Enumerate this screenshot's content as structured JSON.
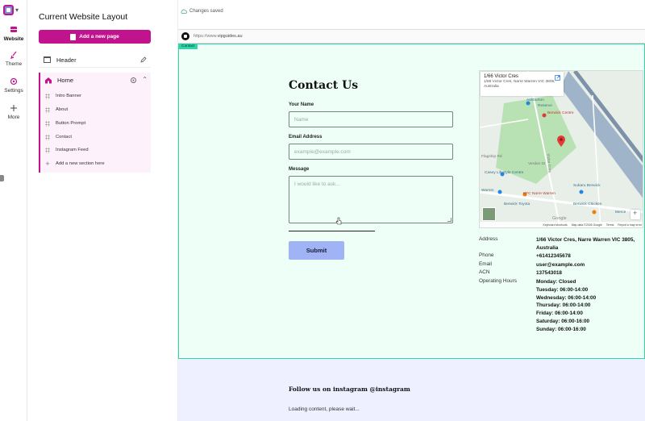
{
  "rail": {
    "items": [
      {
        "label": "Website"
      },
      {
        "label": "Theme"
      },
      {
        "label": "Settings"
      },
      {
        "label": "More"
      }
    ]
  },
  "panel": {
    "title": "Current Website Layout",
    "add_page_label": "Add a new page",
    "header_label": "Header",
    "home": {
      "label": "Home",
      "sections": [
        "Intro Banner",
        "About",
        "Button Prompt",
        "Contact",
        "Instagram Feed"
      ],
      "add_section_label": "Add a new section here"
    }
  },
  "status": {
    "text": "Changes saved"
  },
  "browser": {
    "url_prefix": "https://www.",
    "url_domain": "vipguides.au"
  },
  "contact": {
    "section_tag": "Contact",
    "title": "Contact Us",
    "name_label": "Your Name",
    "name_placeholder": "Name",
    "email_label": "Email Address",
    "email_placeholder": "example@example.com",
    "message_label": "Message",
    "message_placeholder": "I would like to ask...",
    "submit_label": "Submit",
    "map": {
      "place_name": "1/66 Victor Cres",
      "place_address": "1/66 Victor Cres, Narre Warren VIC 3805, Australia",
      "labels": {
        "ashburton": "Ashburton",
        "reserve": "Reserve",
        "berwick_centre": "Berwick Centre",
        "victor_cres": "Victor Cres",
        "flagship": "Flagship Rd",
        "verdun": "Verdun Dr",
        "lifestyle": "Casey Lifestyle Centre",
        "warren": "Warren",
        "kfc": "KFC Narre Warren",
        "subaru": "Subaru Berwick",
        "toyota": "Berwick Toyota",
        "berwick_chicken": "Berwick Chicken",
        "merce": "Merce",
        "google": "Google"
      },
      "footer": [
        "Keyboard shortcuts",
        "Map data ©2026 Google",
        "Terms",
        "Report a map error"
      ]
    },
    "info": [
      {
        "key": "Address",
        "value": "1/66 Victor Cres, Narre Warren VIC 3805, Australia"
      },
      {
        "key": "Phone",
        "value": "+61412345678"
      },
      {
        "key": "Email",
        "value": "user@example.com"
      },
      {
        "key": "ACN",
        "value": "137543018"
      }
    ],
    "hours_label": "Operating Hours",
    "hours": [
      "Monday: Closed",
      "Tuesday: 06:00-14:00",
      "Wednesday: 06:00-14:00",
      "Thursday: 06:00-14:00",
      "Friday: 06:00-14:00",
      "Saturday: 06:00-16:00",
      "Sunday: 06:00-16:00"
    ]
  },
  "instagram": {
    "title": "Follow us on instagram @instagram",
    "loading": "Loading content, please wait..."
  },
  "colors": {
    "brand": "#c2138f",
    "section_outline": "#2fd4a7",
    "submit": "#9fb3f5"
  }
}
